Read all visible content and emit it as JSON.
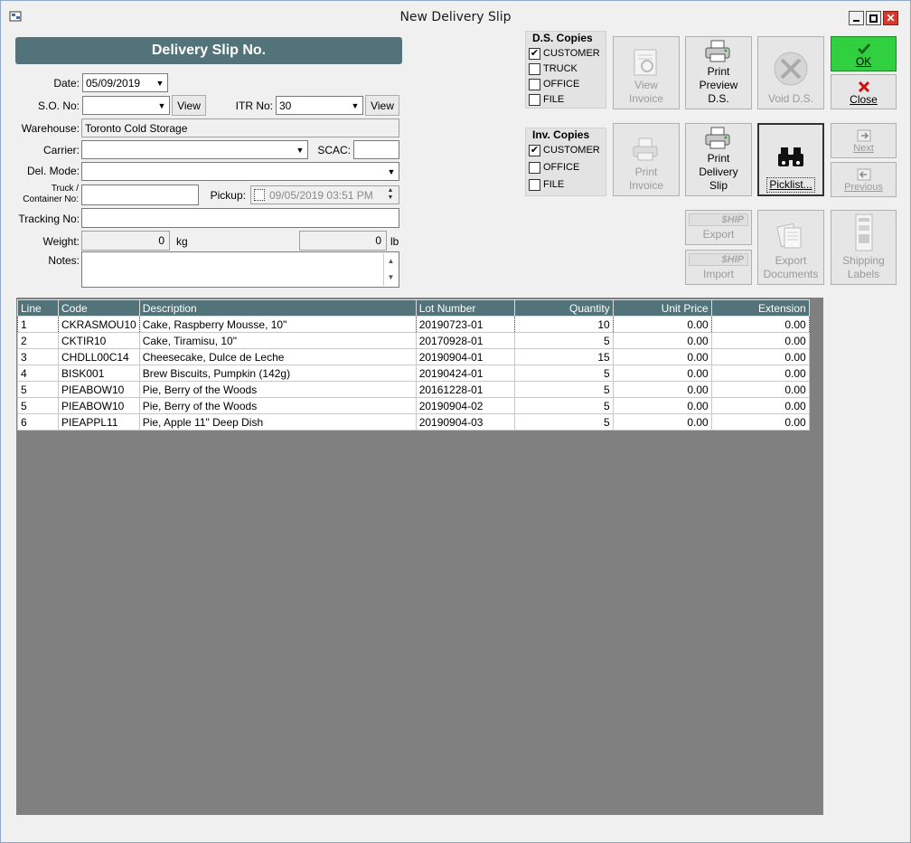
{
  "window": {
    "title": "New Delivery Slip"
  },
  "form": {
    "header": "Delivery Slip No.",
    "date_label": "Date:",
    "date_value": "05/09/2019",
    "so_label": "S.O. No:",
    "so_value": "",
    "view_label": "View",
    "itr_label": "ITR No:",
    "itr_value": "30",
    "warehouse_label": "Warehouse:",
    "warehouse_value": "Toronto Cold Storage",
    "carrier_label": "Carrier:",
    "carrier_value": "",
    "scac_label": "SCAC:",
    "scac_value": "",
    "delmode_label": "Del. Mode:",
    "delmode_value": "",
    "truck_label_1": "Truck /",
    "truck_label_2": "Container No:",
    "truck_value": "",
    "pickup_label": "Pickup:",
    "pickup_value": "09/05/2019  03:51 PM",
    "tracking_label": "Tracking No:",
    "tracking_value": "",
    "weight_label": "Weight:",
    "weight_kg": "0",
    "kg_unit": "kg",
    "weight_lb": "0",
    "lb_unit": "lb",
    "notes_label": "Notes:",
    "notes_value": ""
  },
  "ds_copies": {
    "title": "D.S. Copies",
    "items": [
      {
        "label": "CUSTOMER",
        "checked": true
      },
      {
        "label": "TRUCK",
        "checked": false
      },
      {
        "label": "OFFICE",
        "checked": false
      },
      {
        "label": "FILE",
        "checked": false
      }
    ]
  },
  "inv_copies": {
    "title": "Inv. Copies",
    "items": [
      {
        "label": "CUSTOMER",
        "checked": true
      },
      {
        "label": "OFFICE",
        "checked": false
      },
      {
        "label": "FILE",
        "checked": false
      }
    ]
  },
  "toolbar": {
    "view_invoice": [
      "View",
      "Invoice"
    ],
    "print_preview": [
      "Print",
      "Preview",
      "D.S."
    ],
    "void_ds": "Void D.S.",
    "ok": "OK",
    "close": "Close",
    "print_invoice": [
      "Print",
      "Invoice"
    ],
    "print_delivery": [
      "Print",
      "Delivery",
      "Slip"
    ],
    "picklist": "Picklist...",
    "next": "Next",
    "previous": "Previous",
    "ship_logo": "$HIP",
    "ship_export": "Export",
    "ship_import": "Import",
    "export_docs": [
      "Export",
      "Documents"
    ],
    "shipping_labels": [
      "Shipping",
      "Labels"
    ]
  },
  "grid": {
    "columns": [
      "Line",
      "Code",
      "Description",
      "Lot Number",
      "Quantity",
      "Unit Price",
      "Extension"
    ],
    "rows": [
      [
        "1",
        "CKRASMOU10",
        "Cake, Raspberry Mousse, 10\"",
        "20190723-01",
        "10",
        "0.00",
        "0.00"
      ],
      [
        "2",
        "CKTIR10",
        "Cake, Tiramisu, 10\"",
        "20170928-01",
        "5",
        "0.00",
        "0.00"
      ],
      [
        "3",
        "CHDLL00C14",
        "Cheesecake, Dulce de Leche",
        "20190904-01",
        "15",
        "0.00",
        "0.00"
      ],
      [
        "4",
        "BISK001",
        "Brew Biscuits, Pumpkin (142g)",
        "20190424-01",
        "5",
        "0.00",
        "0.00"
      ],
      [
        "5",
        "PIEABOW10",
        "Pie, Berry of the Woods",
        "20161228-01",
        "5",
        "0.00",
        "0.00"
      ],
      [
        "5",
        "PIEABOW10",
        "Pie, Berry of the Woods",
        "20190904-02",
        "5",
        "0.00",
        "0.00"
      ],
      [
        "6",
        "PIEAPPL11",
        "Pie, Apple 11\" Deep Dish",
        "20190904-03",
        "5",
        "0.00",
        "0.00"
      ]
    ]
  }
}
